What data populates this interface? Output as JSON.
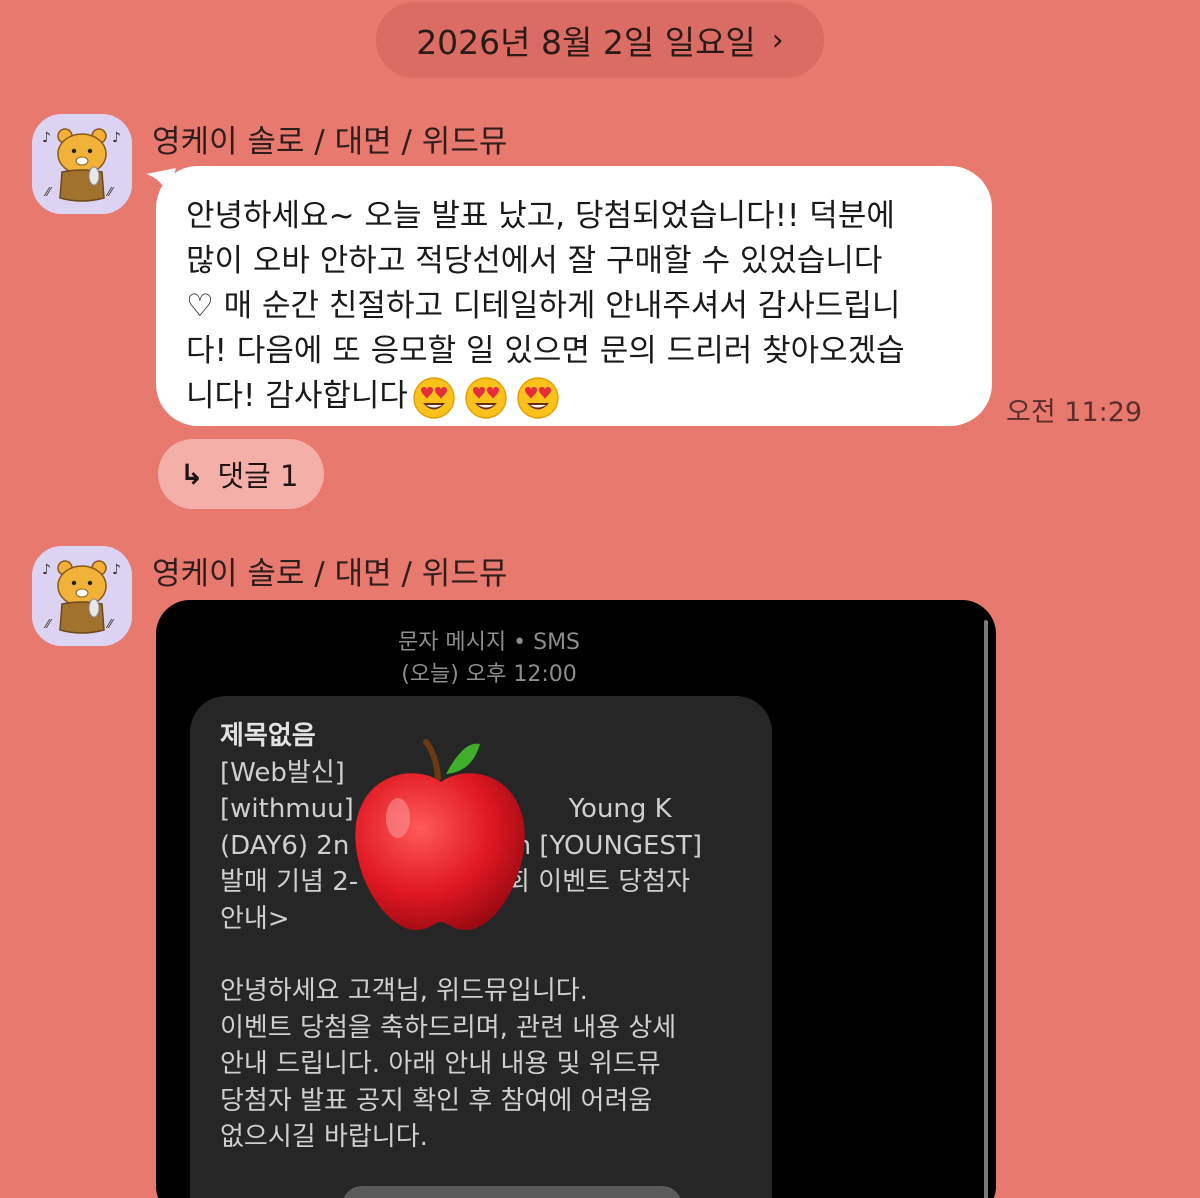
{
  "date_header": {
    "label": "2026년 8월 2일 일요일",
    "chevron": "›"
  },
  "messages": [
    {
      "sender": "영케이 솔로 / 대면 / 위드뮤",
      "avatar_icon": "ryan-singing-avatar",
      "text_lines": [
        "안녕하세요~ 오늘 발표 났고, 당첨되었습니다!! 덕분에",
        "많이 오바 안하고 적당선에서 잘 구매할 수 있었습니다",
        "♡ 매 순간 친절하고 디테일하게 안내주셔서 감사드립니",
        "다! 다음에 또 응모할 일 있으면 문의 드리러 찾아오겠습",
        "니다! 감사합니다"
      ],
      "emojis": [
        "heart-eyes-emoji",
        "heart-eyes-emoji",
        "heart-eyes-emoji"
      ],
      "time": "오전 11:29",
      "reply": {
        "arrow": "↳",
        "label": "댓글 1"
      }
    },
    {
      "sender": "영케이 솔로 / 대면 / 위드뮤",
      "avatar_icon": "ryan-singing-avatar",
      "attachment": {
        "header_line1": "문자 메시지 • SMS",
        "header_line2": "(오늘) 오후 12:00",
        "sms_lines": [
          "제목없음",
          "[Web발신]",
          "[withmuu]                          Young K",
          "(DAY6) 2n                    n [YOUNGEST]",
          "발매 기념 2-               인회 이벤트 당첨자",
          "안내>"
        ],
        "sms_body_lines": [
          "안녕하세요 고객님, 위드뮤입니다.",
          "이벤트 당첨을 축하드리며, 관련 내용 상세",
          "안내 드립니다. 아래 안내 내용 및 위드뮤",
          "당첨자 발표 공지 확인 후 참여에 어려움",
          "없으시길 바랍니다."
        ],
        "cover_icon": "red-apple-emoji"
      }
    }
  ],
  "colors": {
    "background": "#e8796f",
    "date_pill": "#db6c63",
    "bubble": "#ffffff",
    "reply_pill": "#f4b0a8",
    "avatar_bg": "#dcd3f3"
  }
}
